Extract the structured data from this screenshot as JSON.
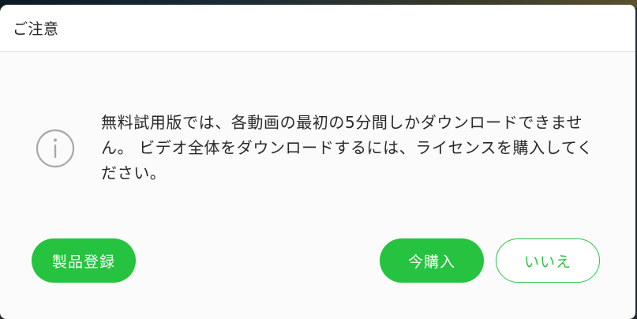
{
  "dialog": {
    "title": "ご注意",
    "icon": "info-circle-icon",
    "message": "無料試用版では、各動画の最初の5分間しかダウンロードできません。 ビデオ全体をダウンロードするには、ライセンスを購入してください。",
    "buttons": {
      "register_label": "製品登録",
      "buy_label": "今購入",
      "no_label": "いいえ"
    },
    "colors": {
      "accent": "#26c340",
      "icon": "#a9a9a9",
      "background": "#fbfbfb"
    }
  }
}
